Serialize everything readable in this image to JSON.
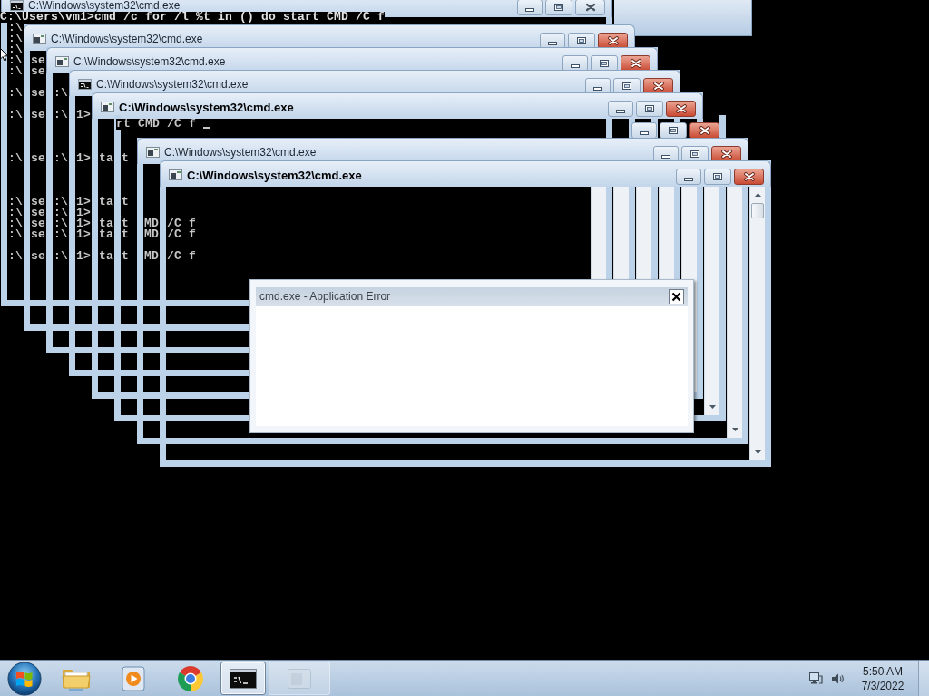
{
  "desktop": {
    "windows": [
      {
        "kind": "console",
        "title": "C:\\Windows\\system32\\cmd.exe",
        "title_bold": false,
        "active": false
      },
      {
        "kind": "plain",
        "title": "C:\\Windows\\system32\\cmd.exe",
        "title_bold": false,
        "active": true
      },
      {
        "kind": "plain",
        "title": "C:\\Windows\\system32\\cmd.exe",
        "title_bold": false,
        "active": true
      },
      {
        "kind": "console",
        "title": "C:\\Windows\\system32\\cmd.exe",
        "title_bold": false,
        "active": true
      },
      {
        "kind": "plain",
        "title": "C:\\Windows\\system32\\cmd.exe",
        "title_bold": true,
        "active": true,
        "console_text": "rt CMD /C f",
        "cursor_visible": true
      },
      {
        "kind": "bare",
        "active": true
      },
      {
        "kind": "plain",
        "title": "C:\\Windows\\system32\\cmd.exe",
        "title_bold": false,
        "active": true
      },
      {
        "kind": "plain",
        "title": "C:\\Windows\\system32\\cmd.exe",
        "title_bold": true,
        "active": true
      }
    ],
    "command_line": "C:\\Users\\vm1>cmd /c for /l %t in () do start CMD /C f",
    "console_rows": [
      {
        "kind": "text",
        "fragments": [
          ":\\"
        ]
      },
      {
        "kind": "text",
        "fragments": [
          ":\\"
        ]
      },
      {
        "kind": "text",
        "fragments": [
          ":\\"
        ]
      },
      {
        "kind": "text",
        "fragments": [
          ":\\",
          "se"
        ]
      },
      {
        "kind": "text",
        "fragments": [
          ":\\",
          "se"
        ]
      },
      {
        "kind": "blank"
      },
      {
        "kind": "text",
        "fragments": [
          ":\\",
          "se",
          ":\\"
        ]
      },
      {
        "kind": "blank"
      },
      {
        "kind": "text",
        "fragments": [
          ":\\",
          "se",
          ":\\",
          "1>"
        ]
      },
      {
        "kind": "blank"
      },
      {
        "kind": "blank"
      },
      {
        "kind": "blank"
      },
      {
        "kind": "text",
        "fragments": [
          ":\\",
          "se",
          ":\\",
          "1>",
          "ta",
          "t"
        ]
      },
      {
        "kind": "blank"
      },
      {
        "kind": "blank"
      },
      {
        "kind": "blank"
      },
      {
        "kind": "text",
        "fragments": [
          ":\\",
          "se",
          ":\\",
          "1>",
          "ta",
          "t"
        ]
      },
      {
        "kind": "text",
        "fragments": [
          ":\\",
          "se",
          ":\\",
          "1>"
        ]
      },
      {
        "kind": "text",
        "fragments": [
          ":\\",
          "se",
          ":\\",
          "1>",
          "ta",
          "t",
          "MD",
          "/C f"
        ]
      },
      {
        "kind": "text",
        "fragments": [
          ":\\",
          "se",
          ":\\",
          "1>",
          "ta",
          "t",
          "MD",
          "/C f"
        ]
      },
      {
        "kind": "blank"
      },
      {
        "kind": "text",
        "fragments": [
          ":\\",
          "se",
          ":\\",
          "1>",
          "ta",
          "t",
          "MD",
          "/C f"
        ]
      }
    ]
  },
  "dialog": {
    "title": "cmd.exe - Application Error"
  },
  "taskbar": {
    "items": [
      {
        "kind": "folder",
        "selected": false,
        "dimmed": false
      },
      {
        "kind": "media",
        "selected": false,
        "dimmed": false
      },
      {
        "kind": "browser",
        "selected": false,
        "dimmed": false
      },
      {
        "kind": "console",
        "selected": true,
        "dimmed": false
      },
      {
        "kind": "window",
        "selected": false,
        "dimmed": true
      }
    ],
    "clock": {
      "time": "5:50 AM",
      "date": "7/3/2022"
    }
  }
}
